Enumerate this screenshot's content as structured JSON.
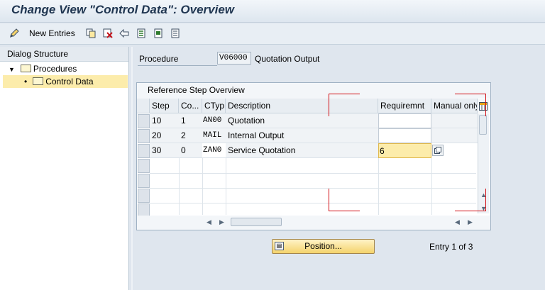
{
  "window": {
    "title": "Change View \"Control Data\": Overview"
  },
  "toolbar": {
    "items": [
      {
        "icon": "edit-pencil-icon"
      },
      {
        "label": "New Entries"
      },
      {
        "icon": "copy-icon"
      },
      {
        "icon": "delete-icon"
      },
      {
        "icon": "undo-icon"
      },
      {
        "icon": "select-all-icon"
      },
      {
        "icon": "select-block-icon"
      },
      {
        "icon": "deselect-all-icon"
      }
    ],
    "new_entries_label": "New Entries"
  },
  "tree": {
    "header": "Dialog Structure",
    "items": [
      {
        "label": "Procedures",
        "expanded": true
      },
      {
        "label": "Control Data",
        "selected": true
      }
    ]
  },
  "procedure": {
    "label": "Procedure",
    "value": "V06000",
    "description": "Quotation Output"
  },
  "table": {
    "title": "Reference Step Overview",
    "columns": [
      "Step",
      "Co...",
      "CTyp",
      "Description",
      "Requiremnt",
      "Manual only"
    ],
    "rows": [
      {
        "step": "10",
        "counter": "1",
        "ctyp": "AN00",
        "description": "Quotation",
        "requirement": "",
        "manual": ""
      },
      {
        "step": "20",
        "counter": "2",
        "ctyp": "MAIL",
        "description": "Internal Output",
        "requirement": "",
        "manual": ""
      },
      {
        "step": "30",
        "counter": "0",
        "ctyp": "ZAN0",
        "description": "Service Quotation",
        "requirement": "6",
        "manual": ""
      }
    ]
  },
  "position_button": {
    "label": "Position..."
  },
  "entry_info": "Entry 1 of 3",
  "colors": {
    "highlight": "#fcecab",
    "annotation_red": "#d10c12"
  }
}
